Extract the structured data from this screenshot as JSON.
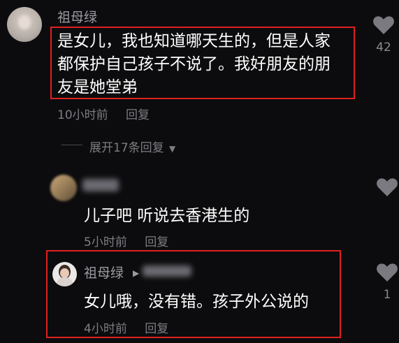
{
  "comment1": {
    "username": "祖母绿",
    "text_line1": "是女儿，我也知道哪天生的，但是人家",
    "text_line2": "都保护自己孩子不说了。我好朋友的朋",
    "text_line3": "友是她堂弟",
    "time": "10小时前",
    "reply_label": "回复",
    "likes": "42",
    "expand_label": "展开17条回复"
  },
  "comment2": {
    "text": "儿子吧 听说去香港生的",
    "time": "5小时前",
    "reply_label": "回复"
  },
  "comment3": {
    "username": "祖母绿",
    "text": "女儿哦，没有错。孩子外公说的",
    "time": "4小时前",
    "reply_label": "回复",
    "likes": "1"
  },
  "colors": {
    "background": "#0c0c0e",
    "highlight": "#e02020",
    "meta": "#7d7d82"
  }
}
